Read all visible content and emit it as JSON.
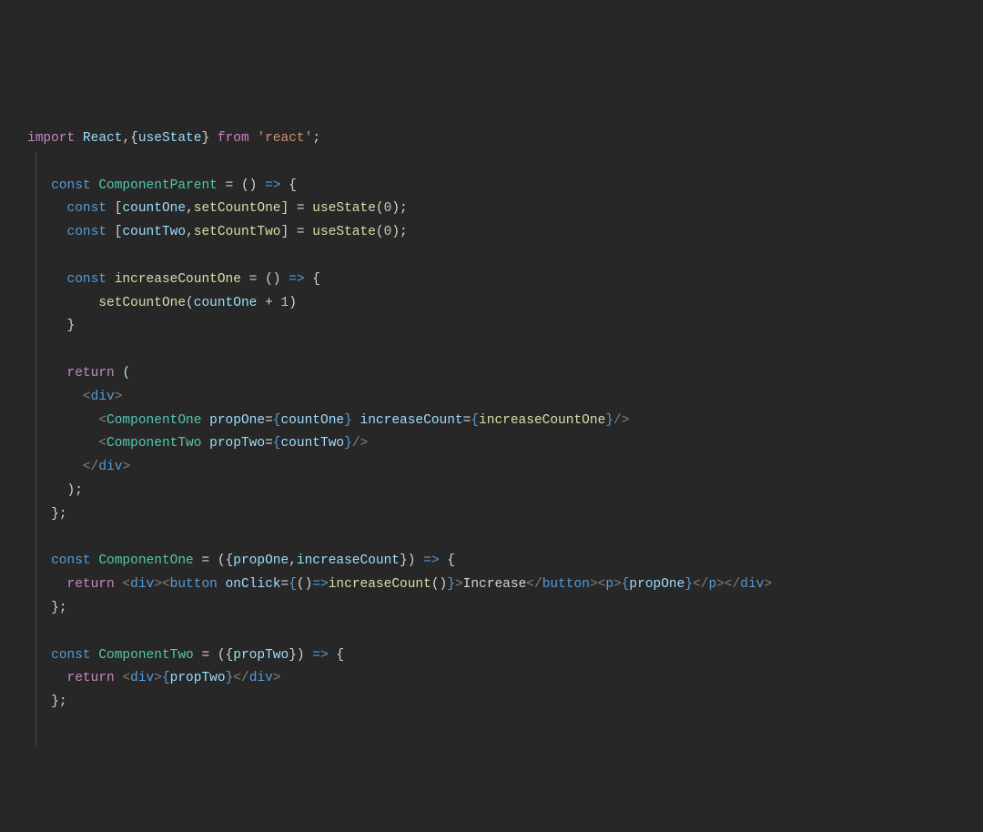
{
  "tokens": {
    "import": "import",
    "React": "React",
    "useState": "useState",
    "from": "from",
    "react_str": "'react'",
    "const": "const",
    "ComponentParent": "ComponentParent",
    "countOne": "countOne",
    "setCountOne": "setCountOne",
    "countTwo": "countTwo",
    "setCountTwo": "setCountTwo",
    "zero": "0",
    "one": "1",
    "increaseCountOne": "increaseCountOne",
    "return": "return",
    "div": "div",
    "ComponentOne": "ComponentOne",
    "ComponentTwo": "ComponentTwo",
    "propOne": "propOne",
    "propTwo": "propTwo",
    "increaseCount": "increaseCount",
    "button": "button",
    "onClick": "onClick",
    "Increase": "Increase",
    "p": "p",
    "arrow": "=>",
    "eq": "=",
    "comma": ",",
    "semi": ";",
    "lparen": "(",
    "rparen": ")",
    "lbrace": "{",
    "rbrace": "}",
    "lbracket": "[",
    "rbracket": "]",
    "lt": "<",
    "gt": ">",
    "slash": "/",
    "plus": "+",
    "space": " "
  }
}
